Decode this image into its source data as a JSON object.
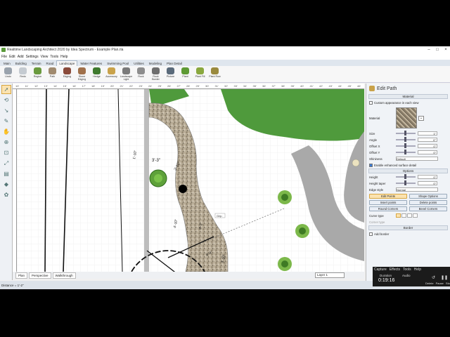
{
  "window": {
    "title": "Realtime Landscaping Architect 2020 by Idea Spectrum - Example Plan.rla"
  },
  "menu": [
    "File",
    "Edit",
    "Add",
    "Settings",
    "View",
    "Tools",
    "Help"
  ],
  "tabs": [
    "Main",
    "Building",
    "Terrain",
    "Road",
    "Landscape",
    "Water Features",
    "Swimming Pool",
    "Utilities",
    "Modeling",
    "Plan Detail"
  ],
  "active_tab": "Landscape",
  "ribbon": [
    {
      "label": "Undo",
      "icon": "undo-icon",
      "color": "#9aa3ad"
    },
    {
      "label": "Redo",
      "icon": "redo-icon",
      "color": "#c5cbd1"
    },
    {
      "label": "Region",
      "icon": "region-icon",
      "color": "#6a9a3e"
    },
    {
      "label": "Path",
      "icon": "path-icon",
      "color": "#a08a6e"
    },
    {
      "label": "Edging",
      "icon": "edging-icon",
      "color": "#8a4a3a"
    },
    {
      "label": "Stone Edging",
      "icon": "stone-edging-icon",
      "color": "#a0704a"
    },
    {
      "label": "Hedge",
      "icon": "hedge-icon",
      "color": "#3f7a2e"
    },
    {
      "label": "Accessory",
      "icon": "accessory-icon",
      "color": "#c9a24a"
    },
    {
      "label": "Landscape Light",
      "icon": "light-icon",
      "color": "#7a7a7a"
    },
    {
      "label": "Rock",
      "icon": "rock-icon",
      "color": "#8d8d8d"
    },
    {
      "label": "Rock Border",
      "icon": "rock-border-icon",
      "color": "#6f6f6f"
    },
    {
      "label": "Picture",
      "icon": "picture-icon",
      "color": "#5a6a7a"
    },
    {
      "label": "Plant",
      "icon": "plant-icon",
      "color": "#5e9a34"
    },
    {
      "label": "Plant Fill",
      "icon": "plant-fill-icon",
      "color": "#8aa83e"
    },
    {
      "label": "Plant Row",
      "icon": "plant-row-icon",
      "color": "#9a8a3e"
    }
  ],
  "ruler_labels": [
    "10'",
    "11'",
    "12'",
    "13'",
    "14'",
    "15'",
    "16'",
    "17'",
    "18'",
    "19'",
    "20'",
    "21'",
    "22'",
    "23'",
    "24'",
    "25'",
    "26'",
    "27'",
    "28'",
    "29'",
    "30'",
    "31'",
    "32'",
    "33'",
    "34'",
    "35'",
    "36'",
    "37'",
    "38'",
    "39'",
    "40'",
    "41'",
    "42'",
    "43'",
    "44'",
    "45'",
    "46'"
  ],
  "canvas": {
    "dimensions": [
      "3'-3\"",
      "3'-10\"",
      "4'-10\"",
      "4'-1\"",
      "3'-10\"",
      "1'-10\"",
      "4'-4\""
    ],
    "tooltip": "Grip"
  },
  "bottom_tabs": [
    "Plan",
    "Perspective",
    "Walkthrough"
  ],
  "layer": "Layer 1",
  "status": "Distance = 1'-2\"",
  "panel": {
    "title": "Edit Path",
    "sections": {
      "material": "Material",
      "options": "Options",
      "border": "Border"
    },
    "custom_appearance": "Custom appearance in each view",
    "material_label": "Material",
    "rows": [
      {
        "k": "Size",
        "v": "1\""
      },
      {
        "k": "Angle",
        "v": "0°"
      },
      {
        "k": "Offset X",
        "v": "0\""
      },
      {
        "k": "Offset Y",
        "v": "0\""
      }
    ],
    "shininess": {
      "k": "Shininess",
      "v": "Default"
    },
    "enhanced": "Enable enhanced surface detail",
    "height": {
      "k": "Height",
      "v": "0\""
    },
    "height_taper": {
      "k": "Height taper",
      "v": "0\""
    },
    "edge_style": {
      "k": "Edge style",
      "v": "Normal"
    },
    "buttons": [
      "Edit Points",
      "Shape Options",
      "Insert points",
      "Delete points",
      "Round Corners",
      "Bevel Corners"
    ],
    "curve_type": "Curve type",
    "corner_type": "Corner type",
    "add_border": "Add border"
  },
  "video": {
    "menu": [
      "Capture",
      "Effects",
      "Tools",
      "Help"
    ],
    "duration_label": "Duration",
    "audio_label": "Audio",
    "time": "0:19:16",
    "controls": [
      "Delete",
      "Pause",
      "Stop"
    ]
  }
}
